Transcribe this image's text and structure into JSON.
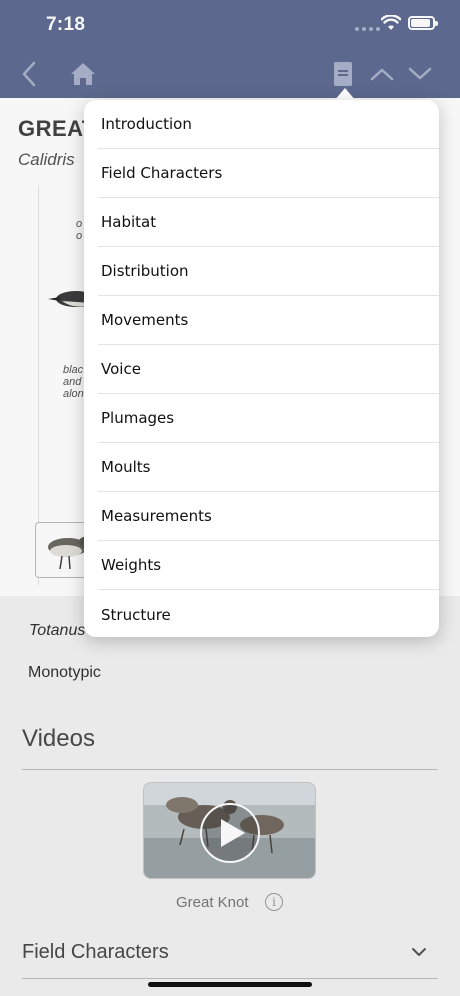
{
  "status_bar": {
    "time": "7:18"
  },
  "toolbar": {
    "back_icon": "chevron-left-icon",
    "home_icon": "home-icon",
    "contents_icon": "book-icon",
    "prev_icon": "chevron-up-icon",
    "next_icon": "chevron-down-icon"
  },
  "species": {
    "title": "GREAT",
    "scientific": "Calidris",
    "plate_text_1": [
      "o",
      "o"
    ],
    "plate_text_2": [
      "blac",
      "and",
      "alon"
    ]
  },
  "content": {
    "totanus": "Totanus",
    "monotypic": "Monotypic",
    "videos_heading": "Videos",
    "video_caption": "Great Knot",
    "info_icon": "info-icon",
    "field_characters": "Field Characters",
    "expand_icon": "chevron-down-icon"
  },
  "menu": {
    "items": [
      "Introduction",
      "Field Characters",
      "Habitat",
      "Distribution",
      "Movements",
      "Voice",
      "Plumages",
      "Moults",
      "Measurements",
      "Weights",
      "Structure"
    ]
  },
  "colors": {
    "toolbar": "#5f6c92",
    "toolbar_icon": "#aab3cc",
    "background": "#f2f2f2"
  }
}
